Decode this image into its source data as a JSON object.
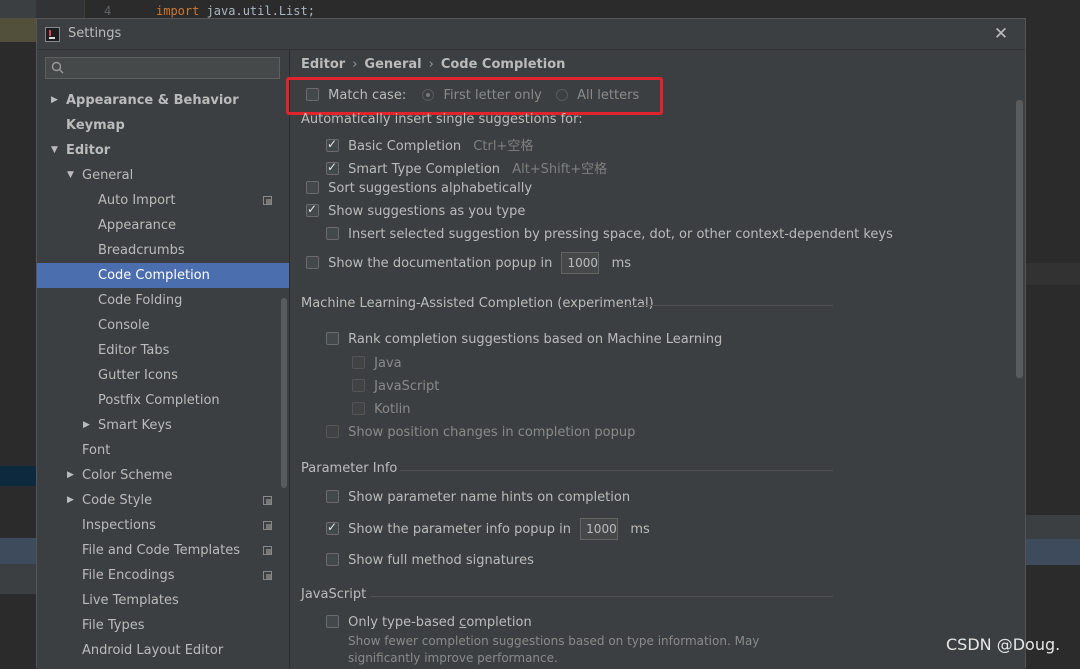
{
  "editor_bg": {
    "line_number": "4",
    "code_keyword": "import",
    "code_rest": " java.util.List;"
  },
  "dialog": {
    "title": "Settings",
    "close_symbol": "✕"
  },
  "search": {
    "placeholder": "",
    "value": ""
  },
  "tree": {
    "items": [
      {
        "label": "Appearance & Behavior"
      },
      {
        "label": "Keymap"
      },
      {
        "label": "Editor"
      },
      {
        "label": "General"
      },
      {
        "label": "Auto Import"
      },
      {
        "label": "Appearance"
      },
      {
        "label": "Breadcrumbs"
      },
      {
        "label": "Code Completion"
      },
      {
        "label": "Code Folding"
      },
      {
        "label": "Console"
      },
      {
        "label": "Editor Tabs"
      },
      {
        "label": "Gutter Icons"
      },
      {
        "label": "Postfix Completion"
      },
      {
        "label": "Smart Keys"
      },
      {
        "label": "Font"
      },
      {
        "label": "Color Scheme"
      },
      {
        "label": "Code Style"
      },
      {
        "label": "Inspections"
      },
      {
        "label": "File and Code Templates"
      },
      {
        "label": "File Encodings"
      },
      {
        "label": "Live Templates"
      },
      {
        "label": "File Types"
      },
      {
        "label": "Android Layout Editor"
      }
    ]
  },
  "breadcrumb": {
    "part1": "Editor",
    "part2": "General",
    "part3": "Code Completion",
    "sep": "›"
  },
  "match_case": {
    "label": "Match case:",
    "checked": false,
    "option_first": "First letter only",
    "option_all": "All letters"
  },
  "auto_insert": {
    "heading": "Automatically insert single suggestions for:",
    "basic_label": "Basic Completion",
    "basic_shortcut": "Ctrl+空格",
    "smart_label": "Smart Type Completion",
    "smart_shortcut": "Alt+Shift+空格"
  },
  "options": {
    "sort_label": "Sort suggestions alphabetically",
    "show_as_type_label": "Show suggestions as you type",
    "insert_selected_label": "Insert selected suggestion by pressing space, dot, or other context-dependent keys",
    "doc_popup_label": "Show the documentation popup in",
    "doc_popup_value": "1000",
    "doc_popup_unit": "ms"
  },
  "ml": {
    "title": "Machine Learning-Assisted Completion (experimental)",
    "rank_label": "Rank completion suggestions based on Machine Learning",
    "java": "Java",
    "javascript": "JavaScript",
    "kotlin": "Kotlin",
    "show_position": "Show position changes in completion popup"
  },
  "param_info": {
    "title": "Parameter Info",
    "hints_label": "Show parameter name hints on completion",
    "popup_label": "Show the parameter info popup in",
    "popup_value": "1000",
    "popup_unit": "ms",
    "full_sig_label": "Show full method signatures"
  },
  "javascript": {
    "title": "JavaScript",
    "only_type_prefix": "Only type-based ",
    "only_type_underlined": "c",
    "only_type_suffix": "ompletion",
    "hint_line1": "Show fewer completion suggestions based on type information. May",
    "hint_line2": "significantly improve performance."
  },
  "watermark": "CSDN @Doug.",
  "colors": {
    "selection": "#4b6eaf",
    "highlight_box": "#e0242b",
    "dialog_bg": "#3c3f41"
  }
}
